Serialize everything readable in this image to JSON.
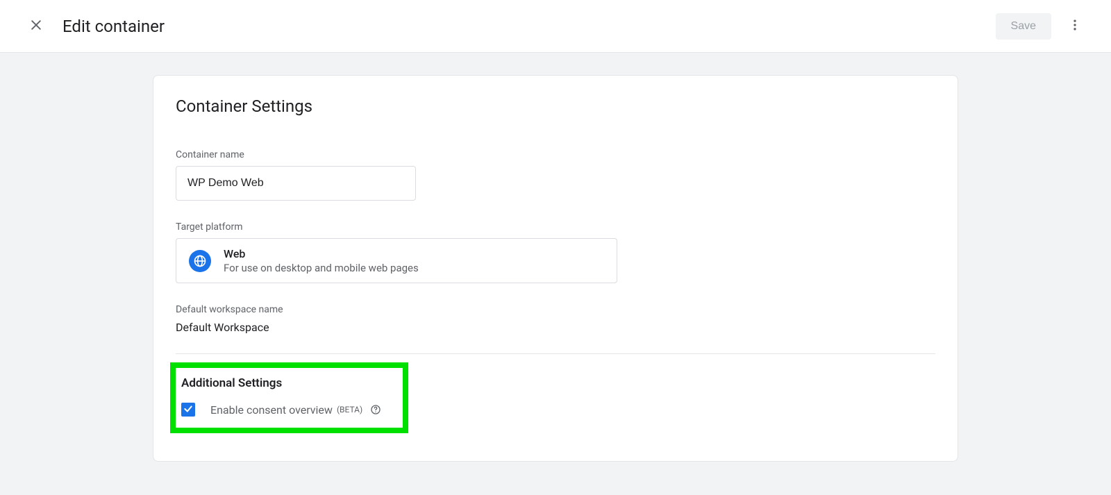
{
  "header": {
    "title": "Edit container",
    "save_label": "Save"
  },
  "container_settings": {
    "section_title": "Container Settings",
    "name_label": "Container name",
    "name_value": "WP Demo Web",
    "target_platform_label": "Target platform",
    "platform_name": "Web",
    "platform_desc": "For use on desktop and mobile web pages",
    "workspace_label": "Default workspace name",
    "workspace_value": "Default Workspace"
  },
  "additional": {
    "section_title": "Additional Settings",
    "consent_label": "Enable consent overview",
    "consent_badge": "(BETA)",
    "consent_checked": true
  }
}
